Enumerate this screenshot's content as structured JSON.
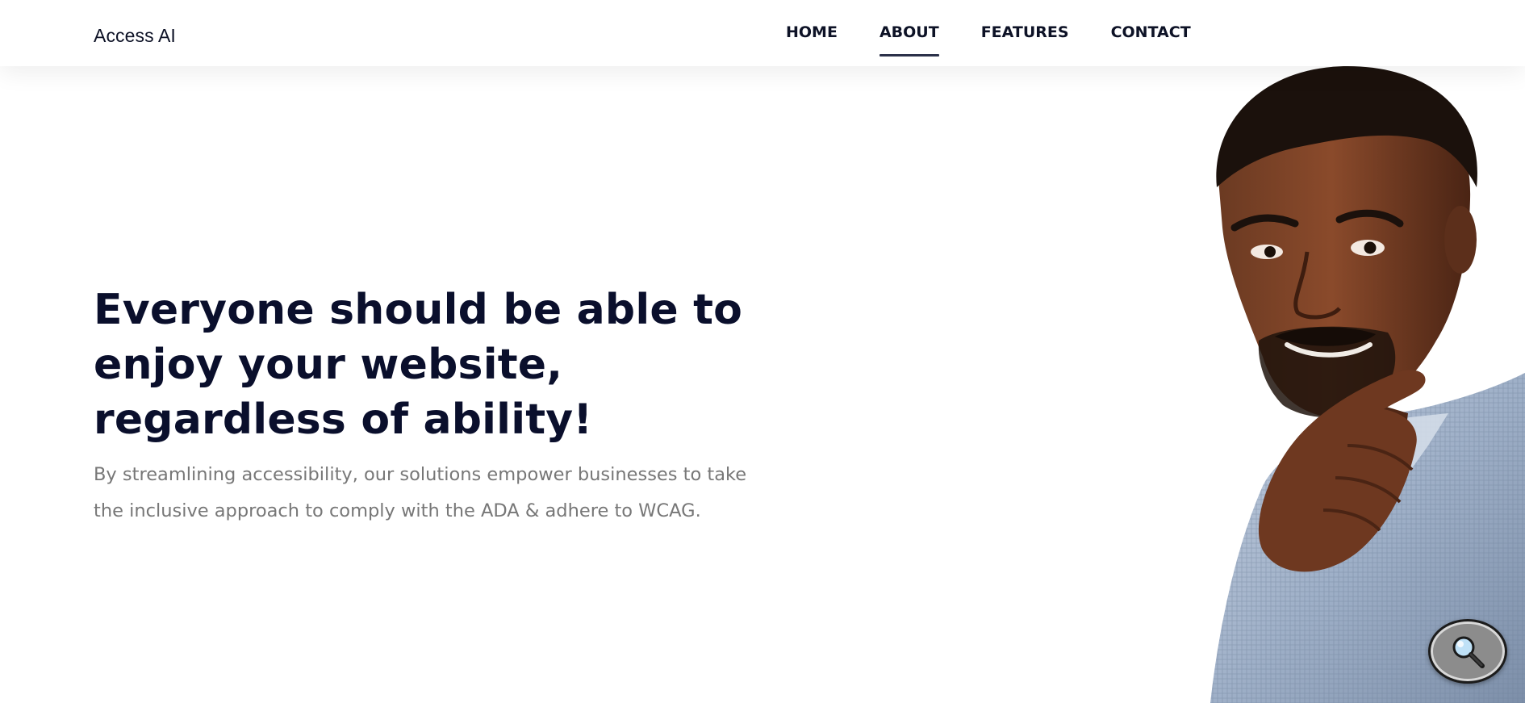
{
  "brand": {
    "name": "Access AI"
  },
  "nav": {
    "items": [
      {
        "label": "HOME",
        "active": false
      },
      {
        "label": "ABOUT",
        "active": true
      },
      {
        "label": "FEATURES",
        "active": false
      },
      {
        "label": "CONTACT",
        "active": false
      }
    ]
  },
  "hero": {
    "title_lines": [
      "Everyone should be able to",
      "enjoy your website,",
      "regardless of ability!"
    ],
    "subtitle_lines": [
      "By streamlining accessibility, our solutions empower businesses to take",
      "the inclusive approach to comply with the ADA & adhere to WCAG."
    ]
  },
  "widgets": {
    "search_button_icon": "magnifier-icon"
  },
  "colors": {
    "heading": "#0a0f2c",
    "body_text": "#777777",
    "nav_text": "#0d1226",
    "nav_active_underline": "#2b3149",
    "background": "#ffffff"
  }
}
